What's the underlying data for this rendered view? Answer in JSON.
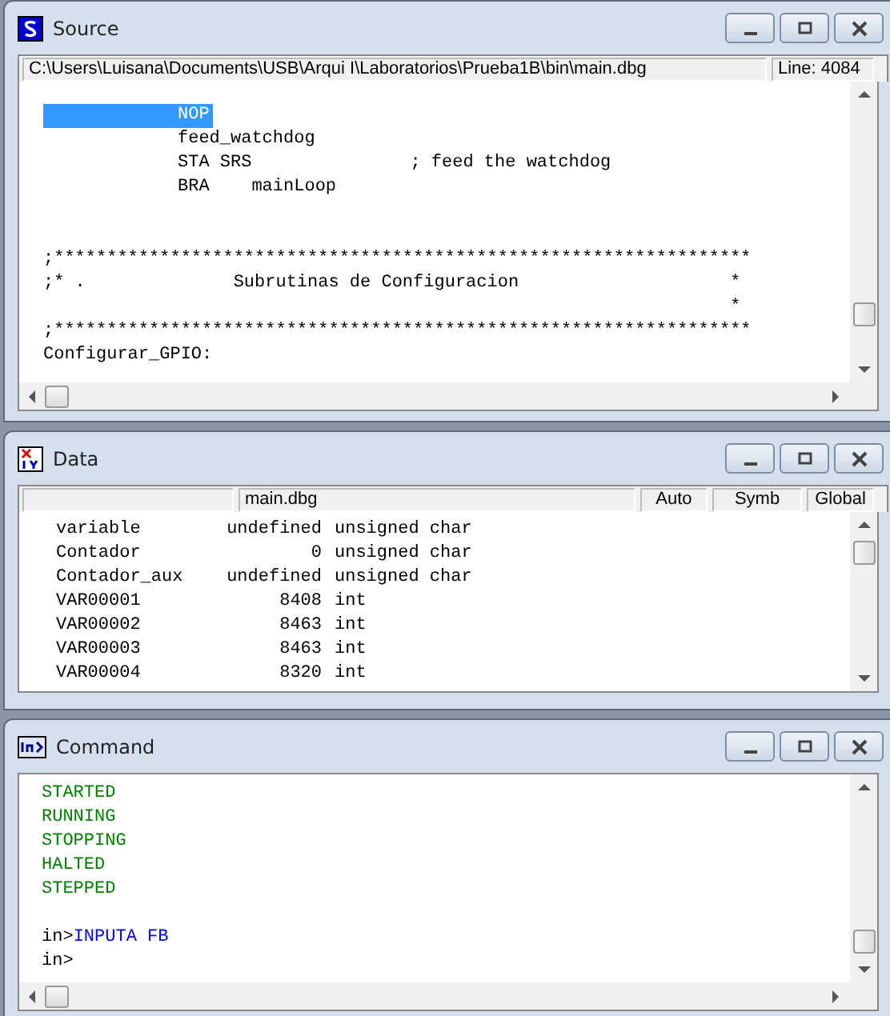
{
  "source": {
    "title": "Source",
    "path": "C:\\Users\\Luisana\\Documents\\USB\\Arqui I\\Laboratorios\\Prueba1B\\bin\\main.dbg",
    "line_indicator": "Line: 4084",
    "blocks": [
      {
        "lines": [
          {
            "kind": "instruction",
            "text": "NOP",
            "selected": true
          },
          {
            "kind": "instruction",
            "text": "feed_watchdog",
            "selected": false
          },
          {
            "kind": "instruction",
            "text": "STA SRS               ; feed the watchdog",
            "selected": false
          },
          {
            "kind": "instruction",
            "text": "BRA    mainLoop",
            "selected": false
          }
        ]
      },
      {
        "lines": [
          {
            "kind": "label",
            "text": ";******************************************************************",
            "selected": false
          },
          {
            "kind": "label",
            "text": ";* .              Subrutinas de Configuracion                    *",
            "selected": false
          },
          {
            "kind": "label",
            "text": "                                                                 *",
            "selected": false
          },
          {
            "kind": "label",
            "text": ";******************************************************************",
            "selected": false
          },
          {
            "kind": "label",
            "text": "Configurar_GPIO:",
            "selected": false
          }
        ]
      }
    ]
  },
  "data": {
    "title": "Data",
    "scope_field": "main.dbg",
    "buttons": [
      "Auto",
      "Symb",
      "Global"
    ],
    "rows": [
      {
        "name": "variable",
        "value": "undefined",
        "type": "unsigned char"
      },
      {
        "name": "Contador",
        "value": "0",
        "type": "unsigned char"
      },
      {
        "name": "Contador_aux",
        "value": "undefined",
        "type": "unsigned char"
      },
      {
        "name": "VAR00001",
        "value": "8408",
        "type": "int"
      },
      {
        "name": "VAR00002",
        "value": "8463",
        "type": "int"
      },
      {
        "name": "VAR00003",
        "value": "8463",
        "type": "int"
      },
      {
        "name": "VAR00004",
        "value": "8320",
        "type": "int"
      }
    ]
  },
  "command": {
    "title": "Command",
    "output": [
      "STARTED",
      "RUNNING",
      "STOPPING",
      "HALTED",
      "STEPPED"
    ],
    "inputs": [
      {
        "prompt": "in>",
        "command": "INPUTA FB"
      },
      {
        "prompt": "in>"
      }
    ]
  }
}
